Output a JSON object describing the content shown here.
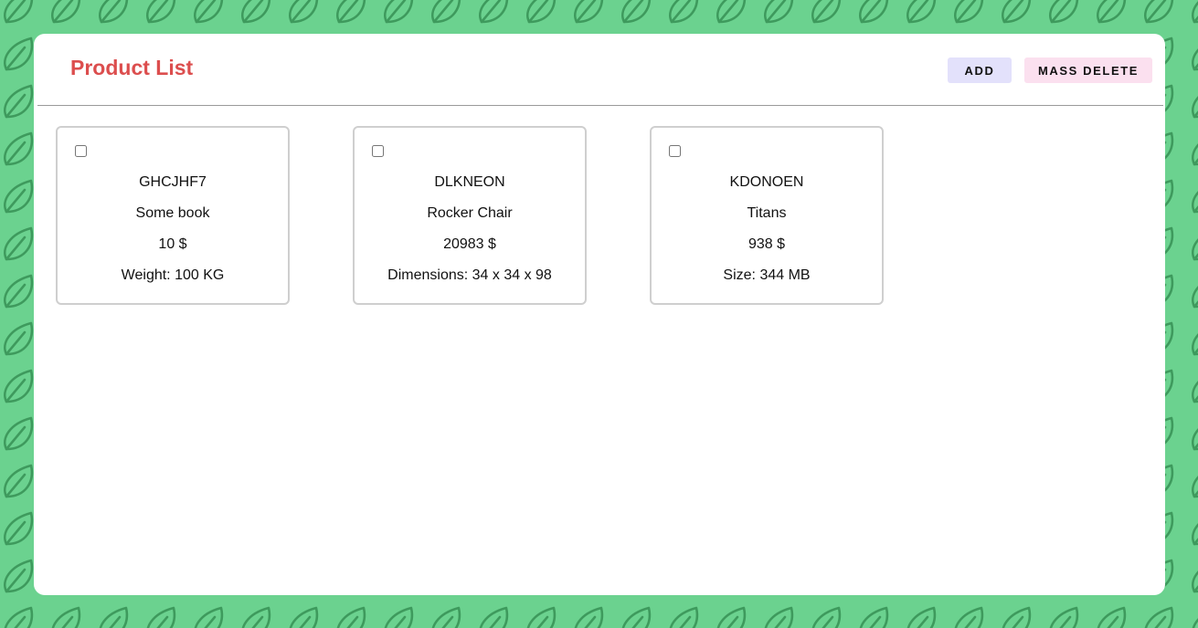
{
  "header": {
    "title": "Product List",
    "add_label": "ADD",
    "mass_delete_label": "MASS DELETE"
  },
  "products": [
    {
      "sku": "GHCJHF7",
      "name": "Some book",
      "price": "10 $",
      "attribute": "Weight: 100 KG",
      "checked": false
    },
    {
      "sku": "DLKNEON",
      "name": "Rocker Chair",
      "price": "20983 $",
      "attribute": "Dimensions: 34 x 34 x 98",
      "checked": false
    },
    {
      "sku": "KDONOEN",
      "name": "Titans",
      "price": "938 $",
      "attribute": "Size: 344 MB",
      "checked": false
    }
  ],
  "colors": {
    "background": "#6bd28f",
    "leaf_pattern": "#3e9a5d",
    "title": "#dc4e4e",
    "add_button": "#e3e1fb",
    "mass_delete_button": "#fbe0ef"
  },
  "background_icon": "leaf-icon"
}
